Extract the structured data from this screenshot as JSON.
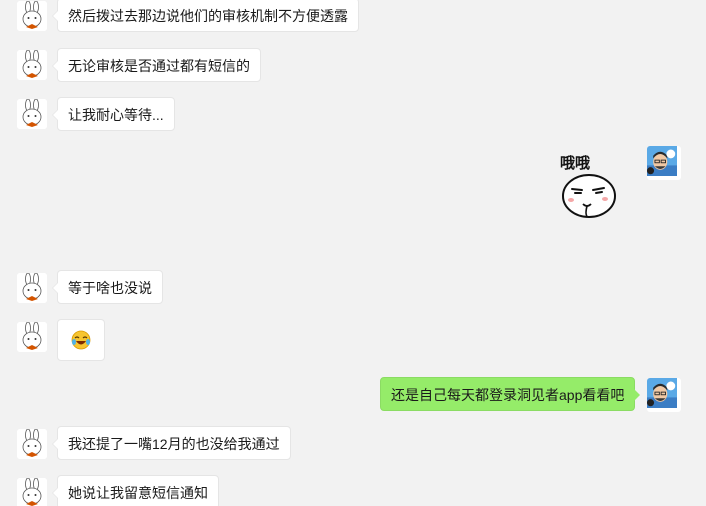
{
  "messages": [
    {
      "side": "left",
      "text": "然后拨过去那边说他们的审核机制不方便透露"
    },
    {
      "side": "left",
      "text": "无论审核是否通过都有短信的"
    },
    {
      "side": "left",
      "text": "让我耐心等待..."
    },
    {
      "side": "right",
      "type": "sticker",
      "caption": "哦哦",
      "icon": "smirk-face-sticker"
    },
    {
      "side": "left",
      "text": "等于啥也没说"
    },
    {
      "side": "left",
      "type": "emoji",
      "icon": "laughing-crying-emoji"
    },
    {
      "side": "right",
      "text": "还是自己每天都登录洞见者app看看吧"
    },
    {
      "side": "left",
      "text": "我还提了一嘴12月的也没给我通过"
    },
    {
      "side": "left",
      "text": "她说让我留意短信通知"
    }
  ],
  "colors": {
    "background": "#f2f2f2",
    "left_bubble": "#ffffff",
    "right_bubble": "#95ec69"
  }
}
